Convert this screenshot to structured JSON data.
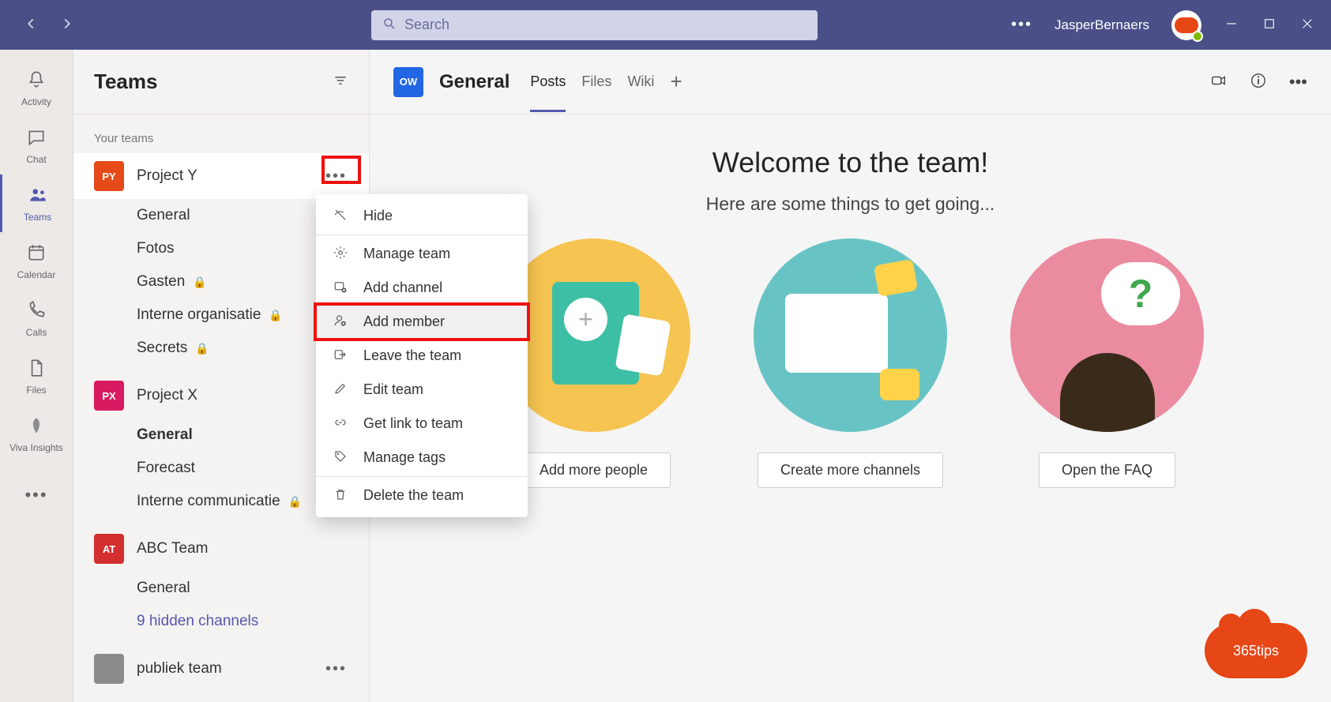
{
  "titlebar": {
    "search_placeholder": "Search",
    "username": "JasperBernaers"
  },
  "nav_rail": {
    "items": [
      {
        "label": "Activity"
      },
      {
        "label": "Chat"
      },
      {
        "label": "Teams"
      },
      {
        "label": "Calendar"
      },
      {
        "label": "Calls"
      },
      {
        "label": "Files"
      },
      {
        "label": "Viva Insights"
      }
    ]
  },
  "sidebar": {
    "title": "Teams",
    "your_teams_label": "Your teams",
    "teams": [
      {
        "name": "Project Y",
        "initials": "PY",
        "color": "#e64a19",
        "channels": [
          {
            "name": "General",
            "private": false
          },
          {
            "name": "Fotos",
            "private": false
          },
          {
            "name": "Gasten",
            "private": true
          },
          {
            "name": "Interne organisatie",
            "private": true
          },
          {
            "name": "Secrets",
            "private": true
          }
        ]
      },
      {
        "name": "Project X",
        "initials": "PX",
        "color": "#d81b60",
        "channels": [
          {
            "name": "General",
            "private": false,
            "bold": true
          },
          {
            "name": "Forecast",
            "private": false
          },
          {
            "name": "Interne communicatie",
            "private": true
          }
        ]
      },
      {
        "name": "ABC Team",
        "initials": "AT",
        "color": "#d32f2f",
        "channels": [
          {
            "name": "General",
            "private": false
          }
        ],
        "hidden_text": "9 hidden channels"
      },
      {
        "name": "publiek team",
        "initials": "",
        "color": "#8b8b8b",
        "channels": []
      }
    ]
  },
  "channel_header": {
    "avatar_text": "OW",
    "title": "General",
    "tabs": [
      {
        "label": "Posts"
      },
      {
        "label": "Files"
      },
      {
        "label": "Wiki"
      }
    ]
  },
  "welcome": {
    "title": "Welcome to the team!",
    "subtitle": "Here are some things to get going...",
    "cards": [
      {
        "button_label": "Add more people"
      },
      {
        "button_label": "Create more channels"
      },
      {
        "button_label": "Open the FAQ"
      }
    ]
  },
  "context_menu": {
    "items": [
      {
        "label": "Hide"
      },
      {
        "label": "Manage team"
      },
      {
        "label": "Add channel"
      },
      {
        "label": "Add member"
      },
      {
        "label": "Leave the team"
      },
      {
        "label": "Edit team"
      },
      {
        "label": "Get link to team"
      },
      {
        "label": "Manage tags"
      },
      {
        "label": "Delete the team"
      }
    ]
  },
  "badge": {
    "text": "365tips"
  }
}
